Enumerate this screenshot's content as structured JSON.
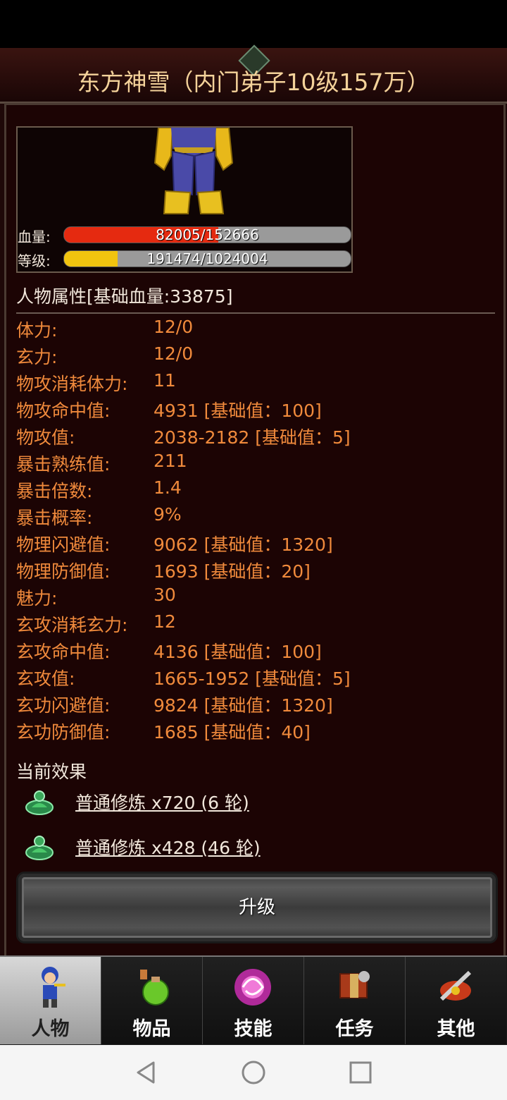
{
  "header": {
    "title": "东方神雪（内门弟子10级157万）"
  },
  "portrait": {
    "hp_label": "血量:",
    "hp_text": "82005/152666",
    "hp_fraction": 0.537,
    "level_label": "等级:",
    "exp_text": "191474/1024004",
    "exp_fraction": 0.187,
    "colors": {
      "hp": "#e52a10",
      "exp": "#f1c40f"
    }
  },
  "attributes": {
    "header": "人物属性[基础血量:33875]",
    "rows": [
      {
        "key": "体力:",
        "value": "12/0"
      },
      {
        "key": "玄力:",
        "value": "12/0"
      },
      {
        "key": "物攻消耗体力:",
        "value": "11"
      },
      {
        "key": "物攻命中值:",
        "value": "4931 [基础值：100]"
      },
      {
        "key": "物攻值:",
        "value": "2038-2182 [基础值：5]"
      },
      {
        "key": "暴击熟练值:",
        "value": "211"
      },
      {
        "key": "暴击倍数:",
        "value": "1.4"
      },
      {
        "key": "暴击概率:",
        "value": "9%"
      },
      {
        "key": "物理闪避值:",
        "value": "9062 [基础值：1320]"
      },
      {
        "key": "物理防御值:",
        "value": "1693 [基础值：20]"
      },
      {
        "key": "魅力:",
        "value": "30"
      },
      {
        "key": "玄攻消耗玄力:",
        "value": "12"
      },
      {
        "key": "玄攻命中值:",
        "value": "4136 [基础值：100]"
      },
      {
        "key": "玄攻值:",
        "value": "1665-1952 [基础值：5]"
      },
      {
        "key": "玄功闪避值:",
        "value": "9824 [基础值：1320]"
      },
      {
        "key": "玄功防御值:",
        "value": "1685 [基础值：40]"
      }
    ]
  },
  "effects": {
    "title": "当前效果",
    "items": [
      {
        "icon": "meditation-icon",
        "text": "普通修炼 x720 (6 轮)"
      },
      {
        "icon": "meditation-icon",
        "text": "普通修炼 x428 (46 轮)"
      }
    ]
  },
  "upgrade_button": {
    "label": "升级"
  },
  "tabs": [
    {
      "label": "人物",
      "icon": "character-icon",
      "active": true
    },
    {
      "label": "物品",
      "icon": "potion-icon",
      "active": false
    },
    {
      "label": "技能",
      "icon": "skill-orb-icon",
      "active": false
    },
    {
      "label": "任务",
      "icon": "quest-icon",
      "active": false
    },
    {
      "label": "其他",
      "icon": "other-icon",
      "active": false
    }
  ],
  "system_nav": {
    "back": "back-icon",
    "home": "home-icon",
    "recents": "recents-icon"
  }
}
